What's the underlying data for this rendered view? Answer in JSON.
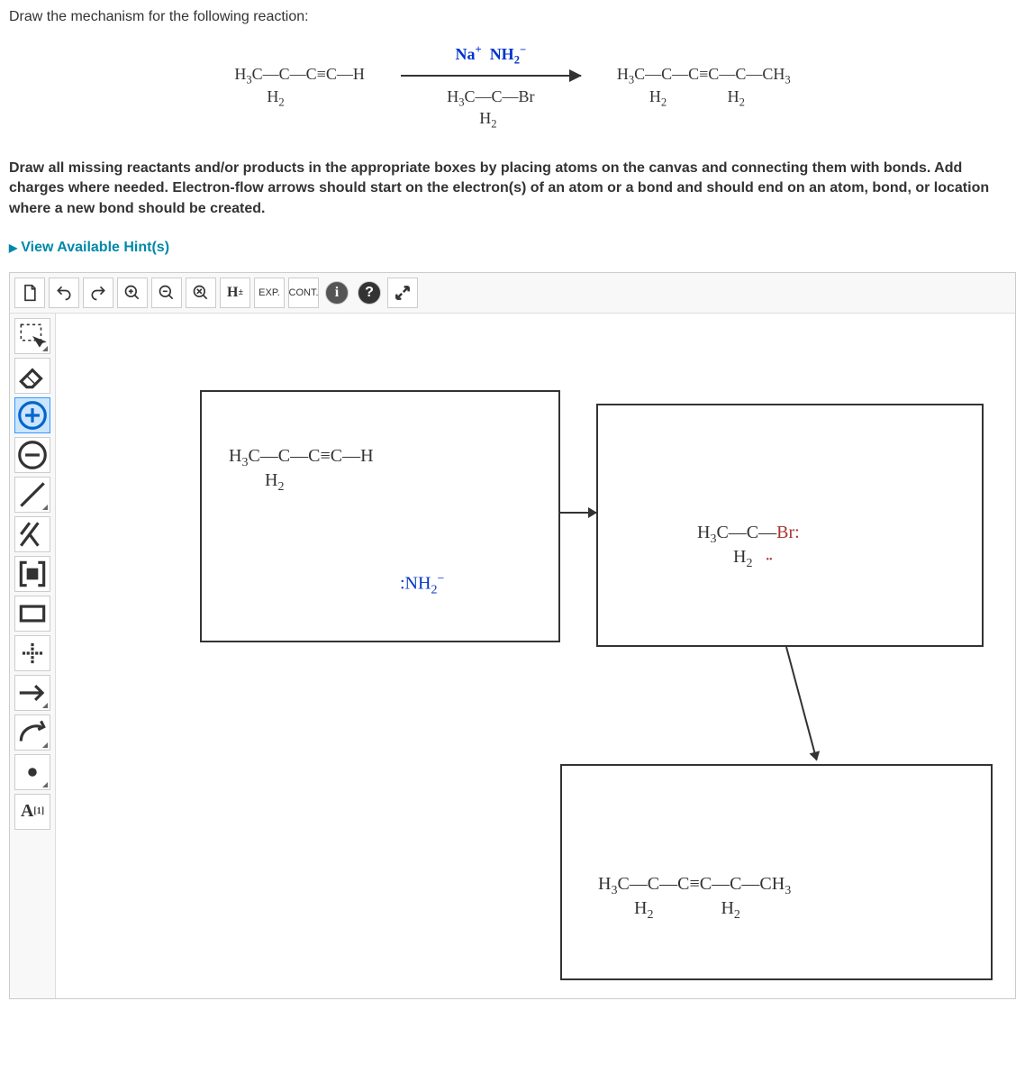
{
  "instruction": "Draw the mechanism for the following reaction:",
  "reaction": {
    "reactant": "H₃C—CH₂—C≡C—H",
    "reagent_above": "Na⁺  NH₂⁻",
    "reagent_below": "H₃C—CH₂—Br",
    "product": "H₃C—CH₂—C≡C—CH₂—CH₃"
  },
  "directions": "Draw all missing reactants and/or products in the appropriate boxes by placing atoms on the canvas and connecting them with bonds. Add charges where needed. Electron-flow arrows should start on the electron(s) of an atom or a bond and should end on an atom, bond, or location where a new bond should be created.",
  "hints_label": "View Available Hint(s)",
  "toolbar_top": {
    "new": "New",
    "undo": "Undo",
    "redo": "Redo",
    "zoom_in": "Zoom In",
    "zoom_out": "Zoom Out",
    "zoom_reset": "Zoom Reset",
    "h_toggle": "H±",
    "exp": "EXP.",
    "cont": "CONT.",
    "info": "Info",
    "help": "Help",
    "expand": "Expand"
  },
  "toolbar_left": {
    "marquee": "Marquee Select",
    "eraser": "Eraser",
    "add_charge": "Increase Charge",
    "sub_charge": "Decrease Charge",
    "single_bond": "Single Bond",
    "double_bond": "Double Bond",
    "bracket": "Bracket",
    "rect": "Rectangle",
    "plus": "Plus Sign",
    "rxn_arrow": "Reaction Arrow",
    "curved_arrow": "Curved Arrow",
    "lone_pair": "Lone Pair",
    "atom_label": "A",
    "atom_super": "[1]"
  },
  "canvas": {
    "box1": {
      "mol1": "H₃C—CH₂—C≡C—H",
      "mol2": ":NH₂⁻"
    },
    "box2": {
      "mol3": "H₃C—CH₂—Br:"
    },
    "box3": {
      "mol4": "H₃C—CH₂—C≡C—CH₂—CH₃"
    }
  }
}
